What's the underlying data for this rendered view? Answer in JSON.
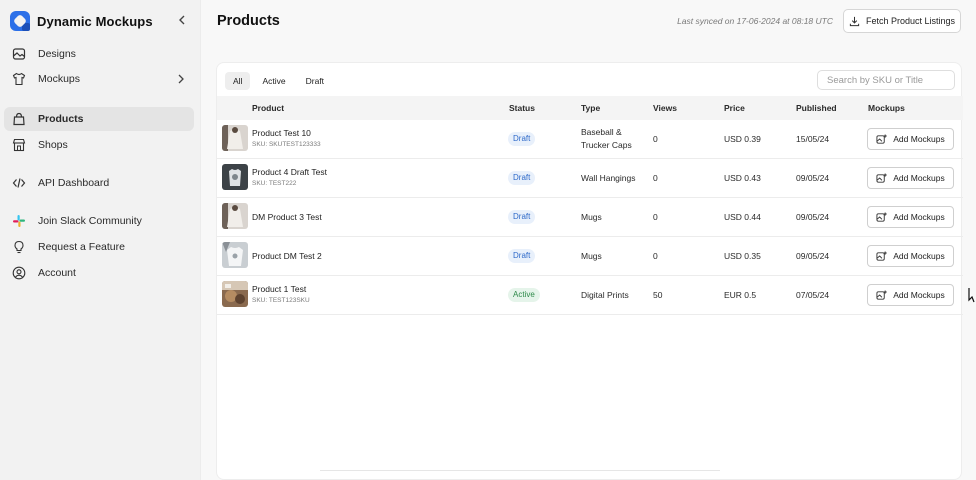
{
  "app": {
    "name": "Dynamic Mockups",
    "accent": "#2b6fe8"
  },
  "sidebar": {
    "items": [
      {
        "label": "Designs",
        "icon": "designs-icon"
      },
      {
        "label": "Mockups",
        "icon": "tshirt-icon"
      },
      {
        "label": "Products",
        "icon": "bag-icon",
        "active": true
      },
      {
        "label": "Shops",
        "icon": "shop-icon"
      },
      {
        "label": "API Dashboard",
        "icon": "code-icon"
      },
      {
        "label": "Join Slack Community",
        "icon": "slack-icon"
      },
      {
        "label": "Request a Feature",
        "icon": "bulb-icon"
      },
      {
        "label": "Account",
        "icon": "user-circle-icon"
      }
    ]
  },
  "header": {
    "title": "Products",
    "sync_text": "Last synced on 17-06-2024 at 08:18 UTC",
    "fetch_label": "Fetch Product Listings"
  },
  "filters": {
    "tabs": [
      "All",
      "Active",
      "Draft"
    ],
    "active_tab": "All",
    "search_placeholder": "Search by SKU or Title"
  },
  "table": {
    "columns": [
      "Product",
      "Status",
      "Type",
      "Views",
      "Price",
      "Published",
      "Mockups"
    ],
    "rows": [
      {
        "name": "Product Test 10",
        "sku": "SKU: SKUTEST123333",
        "status": "Draft",
        "type_line1": "Baseball &",
        "type_line2": "Trucker Caps",
        "views": "0",
        "price": "USD 0.39",
        "published": "15/05/24",
        "mockups_label": "Add Mockups",
        "thumb": "sweater-white"
      },
      {
        "name": "Product 4 Draft Test",
        "sku": "SKU: TEST222",
        "status": "Draft",
        "type_line1": "Wall Hangings",
        "type_line2": "",
        "views": "0",
        "price": "USD 0.43",
        "published": "09/05/24",
        "mockups_label": "Add Mockups",
        "thumb": "tshirt-dark"
      },
      {
        "name": "DM Product 3 Test",
        "sku": "",
        "status": "Draft",
        "type_line1": "Mugs",
        "type_line2": "",
        "views": "0",
        "price": "USD 0.44",
        "published": "09/05/24",
        "mockups_label": "Add Mockups",
        "thumb": "sweater-white"
      },
      {
        "name": "Product DM Test 2",
        "sku": "",
        "status": "Draft",
        "type_line1": "Mugs",
        "type_line2": "",
        "views": "0",
        "price": "USD 0.35",
        "published": "09/05/24",
        "mockups_label": "Add Mockups",
        "thumb": "tshirt-light"
      },
      {
        "name": "Product 1 Test",
        "sku": "SKU: TEST123SKU",
        "status": "Active",
        "type_line1": "Digital Prints",
        "type_line2": "",
        "views": "50",
        "price": "EUR 0.5",
        "published": "07/05/24",
        "mockups_label": "Add Mockups",
        "thumb": "brown-print"
      }
    ]
  }
}
